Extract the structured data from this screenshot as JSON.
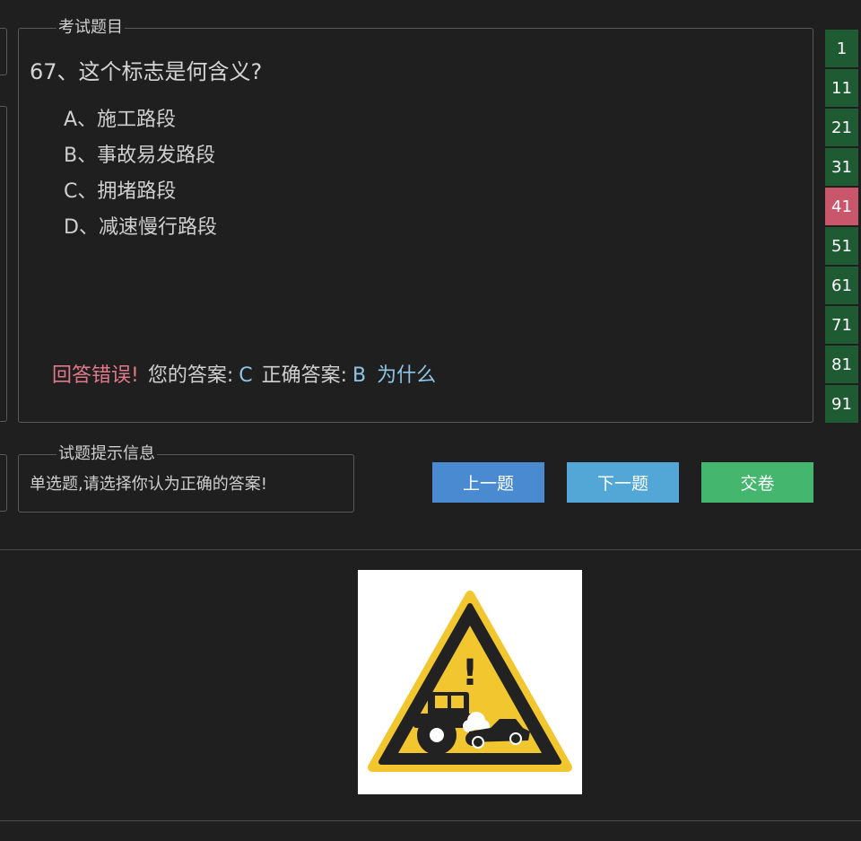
{
  "exam": {
    "legend": "考试题目",
    "question": "67、这个标志是何含义?",
    "options": [
      {
        "label": "A、施工路段"
      },
      {
        "label": "B、事故易发路段"
      },
      {
        "label": "C、拥堵路段"
      },
      {
        "label": "D、减速慢行路段"
      }
    ],
    "result": {
      "status": "回答错误!",
      "your_label": "您的答案:",
      "your_answer": "C",
      "correct_label": "正确答案:",
      "correct_answer": "B",
      "why": "为什么"
    }
  },
  "hint": {
    "legend": "试题提示信息",
    "text": "单选题,请选择你认为正确的答案!"
  },
  "buttons": {
    "prev": "上一题",
    "next": "下一题",
    "submit": "交卷"
  },
  "nav_numbers": [
    "1",
    "11",
    "21",
    "31",
    "41",
    "51",
    "61",
    "71",
    "81",
    "91"
  ],
  "active_nav": "41",
  "sign": {
    "icon": "accident-prone-warning-sign",
    "mark": "!"
  },
  "colors": {
    "background": "#1f1f1f",
    "wrong": "#e07a8a",
    "answer": "#8ec5e6",
    "prev_button": "#4a8ad0",
    "next_button": "#52a7d6",
    "submit_button": "#45b66e",
    "nav_cell": "#1e5a32",
    "nav_active": "#c9566a"
  }
}
